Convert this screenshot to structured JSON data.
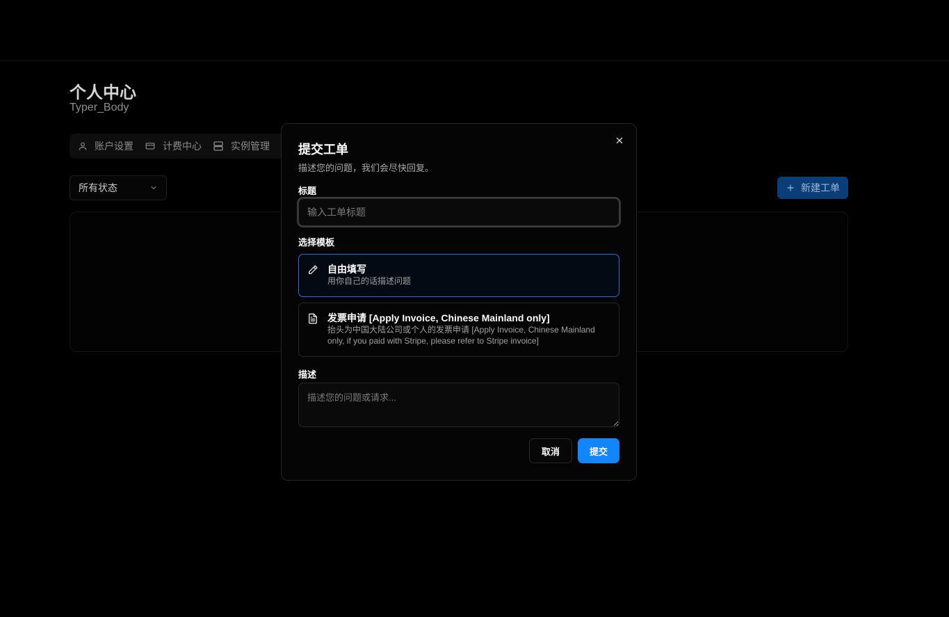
{
  "page": {
    "title": "个人中心",
    "username": "Typer_Body",
    "tabs": [
      {
        "label": "账户设置",
        "icon": "user-icon"
      },
      {
        "label": "计费中心",
        "icon": "credit-card-icon"
      },
      {
        "label": "实例管理",
        "icon": "server-icon"
      }
    ],
    "status_filter": {
      "value": "所有状态",
      "icon": "chevron-down-icon"
    },
    "new_ticket_label": "新建工单"
  },
  "modal": {
    "title": "提交工单",
    "description": "描述您的问题，我们会尽快回复。",
    "title_label": "标题",
    "title_placeholder": "输入工单标题",
    "template_label": "选择模板",
    "templates": [
      {
        "title": "自由填写",
        "description": "用你自己的话描述问题",
        "icon": "pencil-icon",
        "selected": true
      },
      {
        "title": "发票申请 [Apply Invoice, Chinese Mainland only]",
        "description": "抬头为中国大陆公司或个人的发票申请 [Apply Invoice, Chinese Mainland only, if you paid with Stripe, please refer to Stripe invoice]",
        "icon": "document-icon",
        "selected": false
      }
    ],
    "description_label": "描述",
    "description_placeholder": "描述您的问题或请求...",
    "cancel_label": "取消",
    "submit_label": "提交"
  },
  "colors": {
    "accent": "#1286ff",
    "selected_border": "#2f6bd6",
    "background": "#000000"
  }
}
